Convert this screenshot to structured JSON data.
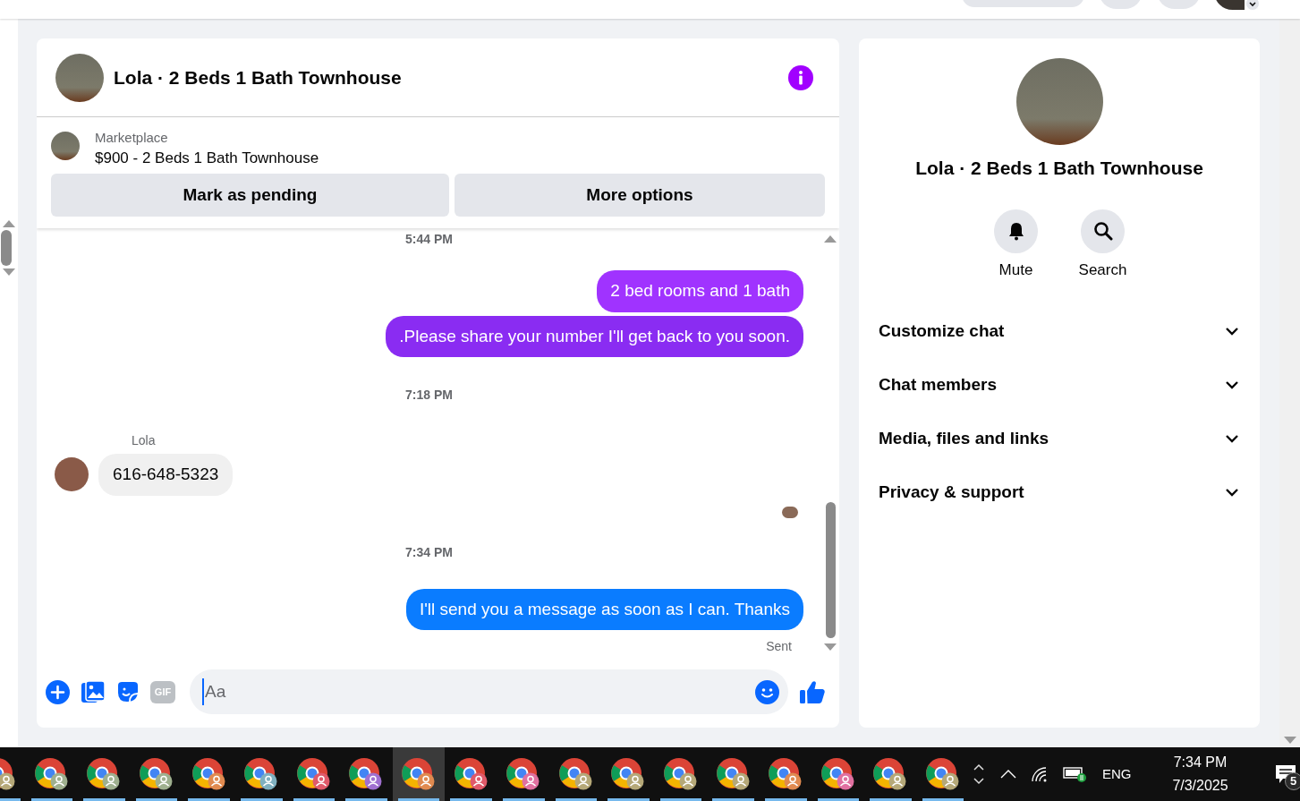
{
  "chat": {
    "title": "Lola · 2 Beds 1 Bath Townhouse",
    "listing": {
      "source": "Marketplace",
      "item": "$900 - 2 Beds 1 Bath Townhouse"
    },
    "actions": [
      "Mark as pending",
      "More options"
    ],
    "messages": [
      {
        "kind": "time",
        "text": "5:44 PM"
      },
      {
        "kind": "outgoing",
        "text": "2 bed rooms and 1 bath",
        "color": "#a033ff"
      },
      {
        "kind": "outgoing",
        "text": ".Please share your number I'll get back to you soon.",
        "color": "#8a2cf2"
      },
      {
        "kind": "time",
        "text": "7:18 PM"
      },
      {
        "kind": "incoming",
        "sender": "Lola",
        "text": "616-648-5323"
      },
      {
        "kind": "seen"
      },
      {
        "kind": "time",
        "text": "7:34 PM"
      },
      {
        "kind": "outgoing",
        "text": "I'll send you a message as soon as I can. Thanks",
        "color": "#0a7cff"
      },
      {
        "kind": "status",
        "text": "Sent"
      }
    ],
    "composer": {
      "gif_label": "GIF",
      "placeholder": "Aa"
    }
  },
  "details": {
    "title": "Lola · 2 Beds 1 Bath Townhouse",
    "actions": [
      {
        "kind": "mute",
        "label": "Mute"
      },
      {
        "kind": "search",
        "label": "Search"
      }
    ],
    "sections": [
      {
        "label": "Customize chat",
        "expanded": false
      },
      {
        "label": "Chat members",
        "expanded": false
      },
      {
        "label": "Media, files and links",
        "expanded": false
      },
      {
        "label": "Privacy & support",
        "expanded": false
      }
    ]
  },
  "taskbar": {
    "apps": [
      {
        "color": "#b5a878",
        "selected": false
      },
      {
        "color": "#9fb08f",
        "selected": false
      },
      {
        "color": "#9fb08f",
        "selected": false
      },
      {
        "color": "#9fb08f",
        "selected": false
      },
      {
        "color": "#e08a50",
        "selected": false
      },
      {
        "color": "#7fb0c0",
        "selected": false
      },
      {
        "color": "#e05a6a",
        "selected": false
      },
      {
        "color": "#a070d0",
        "selected": false
      },
      {
        "color": "#e08a50",
        "selected": true
      },
      {
        "color": "#e05a6a",
        "selected": false
      },
      {
        "color": "#e070a0",
        "selected": false
      },
      {
        "color": "#b5a878",
        "selected": false
      },
      {
        "color": "#b5a878",
        "selected": false
      },
      {
        "color": "#b5a878",
        "selected": false
      },
      {
        "color": "#b5a878",
        "selected": false
      },
      {
        "color": "#e08a50",
        "selected": false
      },
      {
        "color": "#e070a0",
        "selected": false
      },
      {
        "color": "#b5a878",
        "selected": false
      },
      {
        "color": "#b5a878",
        "selected": false
      }
    ],
    "language": "ENG",
    "time": "7:34 PM",
    "date": "7/3/2025",
    "notifications": "5"
  }
}
